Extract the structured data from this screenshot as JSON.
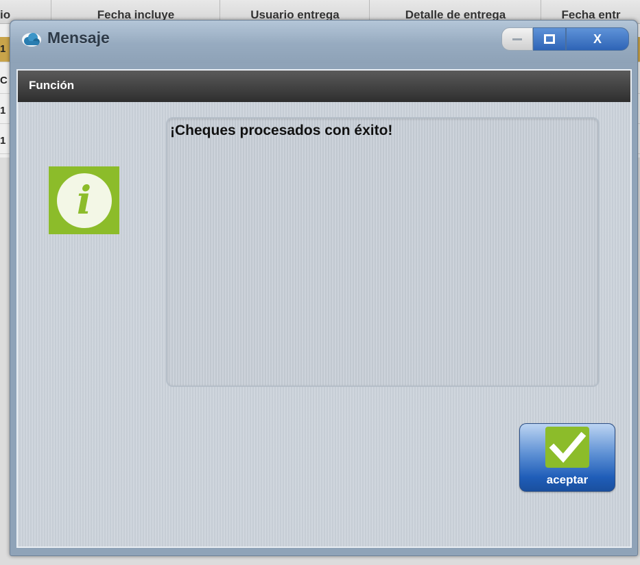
{
  "background_table": {
    "columns": [
      "io",
      "Fecha incluye",
      "Usuario entrega",
      "Detalle de entrega",
      "Fecha entr"
    ],
    "row_cells": [
      "1",
      "C",
      "1",
      "1"
    ]
  },
  "window": {
    "title": "Mensaje",
    "close_label": "X"
  },
  "section": {
    "title": "Función"
  },
  "message": {
    "text": "¡Cheques procesados con éxito!"
  },
  "accept_button": {
    "label": "aceptar"
  },
  "icons": {
    "title": "cloud-app-icon",
    "info": "info-icon",
    "check": "checkmark-icon"
  },
  "colors": {
    "accent_green": "#8cbc2a",
    "window_blue": "#2e64b6",
    "header_dark": "#2e2e2e"
  }
}
